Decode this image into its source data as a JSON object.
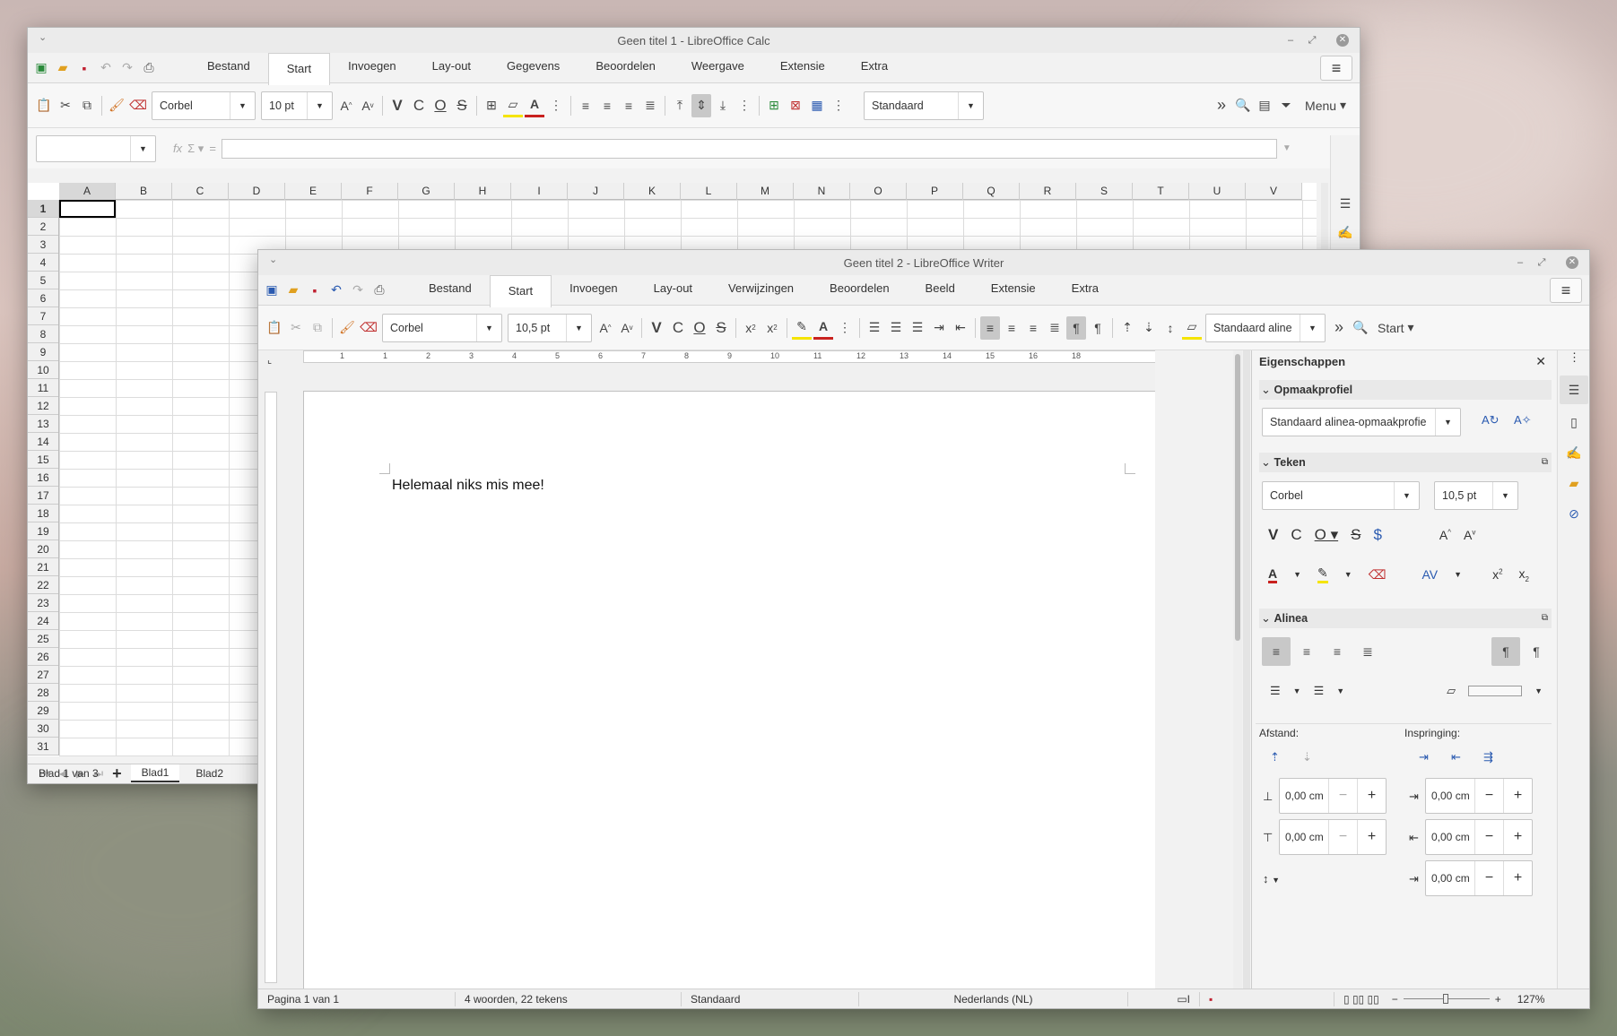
{
  "calc": {
    "title": "Geen titel 1 - LibreOffice Calc",
    "tabs": [
      "Bestand",
      "Start",
      "Invoegen",
      "Lay-out",
      "Gegevens",
      "Beoordelen",
      "Weergave",
      "Extensie",
      "Extra"
    ],
    "font_name": "Corbel",
    "font_size": "10 pt",
    "cell_style": "Standaard",
    "menu_label": "Menu",
    "columns": [
      "A",
      "B",
      "C",
      "D",
      "E",
      "F",
      "G",
      "H",
      "I",
      "J",
      "K",
      "L",
      "M",
      "N",
      "O",
      "P",
      "Q",
      "R",
      "S",
      "T",
      "U",
      "V"
    ],
    "rows": [
      "1",
      "2",
      "3",
      "4",
      "5",
      "6",
      "7",
      "8",
      "9",
      "10",
      "11",
      "12",
      "13",
      "14",
      "15",
      "16",
      "17",
      "18",
      "19",
      "20",
      "21",
      "22",
      "23",
      "24",
      "25",
      "26",
      "27",
      "28",
      "29",
      "30",
      "31"
    ],
    "sheets": [
      "Blad1",
      "Blad2"
    ],
    "status": "Blad 1 van 3"
  },
  "writer": {
    "title": "Geen titel 2 - LibreOffice Writer",
    "tabs": [
      "Bestand",
      "Start",
      "Invoegen",
      "Lay-out",
      "Verwijzingen",
      "Beoordelen",
      "Beeld",
      "Extensie",
      "Extra"
    ],
    "font_name": "Corbel",
    "font_size": "10,5 pt",
    "para_style": "Standaard aline",
    "start_label": "Start",
    "ruler_numbers": [
      "1",
      "1",
      "2",
      "3",
      "4",
      "5",
      "6",
      "7",
      "8",
      "9",
      "10",
      "11",
      "12",
      "13",
      "14",
      "15",
      "16",
      "18"
    ],
    "document_text": "Helemaal niks mis mee!",
    "sidebar": {
      "title": "Eigenschappen",
      "style_section": "Opmaakprofiel",
      "style_value": "Standaard alinea-opmaakprofie",
      "char_section": "Teken",
      "char_font": "Corbel",
      "char_size": "10,5 pt",
      "para_section": "Alinea",
      "spacing_label": "Afstand:",
      "indent_label": "Inspringing:",
      "spacing_above": "0,00 cm",
      "spacing_below": "0,00 cm",
      "indent_before": "0,00 cm",
      "indent_after": "0,00 cm",
      "indent_first": "0,00 cm"
    },
    "status": {
      "page": "Pagina 1 van 1",
      "words": "4 woorden, 22 tekens",
      "style": "Standaard",
      "language": "Nederlands (NL)",
      "zoom": "127%"
    }
  }
}
